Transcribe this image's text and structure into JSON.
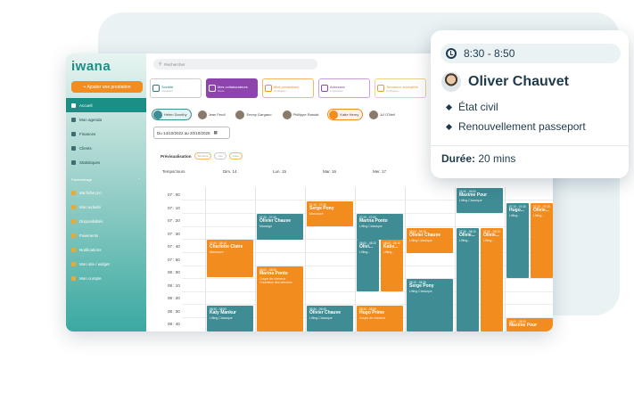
{
  "app": {
    "logo": "iwana",
    "search_placeholder": "Rechercher",
    "add_button": "+ Ajouter une prestation"
  },
  "sidebar": {
    "items": [
      {
        "label": "Accueil",
        "active": true
      },
      {
        "label": "Mon agenda"
      },
      {
        "label": "Finances"
      },
      {
        "label": "Clients"
      },
      {
        "label": "Statistiques"
      }
    ],
    "section": "Paramétrage",
    "section_items": [
      {
        "label": "Ma fiche pro"
      },
      {
        "label": "Mon activité"
      },
      {
        "label": "Disponibilités"
      },
      {
        "label": "Paiements"
      },
      {
        "label": "Notifications"
      },
      {
        "label": "Mon site / widget"
      },
      {
        "label": "Mon compte"
      }
    ]
  },
  "tiles": [
    {
      "label": "Société",
      "sub": "Visualiser",
      "style": "t"
    },
    {
      "label": "Mes collaborateurs",
      "sub": "Gérer",
      "style": "p"
    },
    {
      "label": "Mes prestations",
      "sub": "Configurer",
      "style": "o"
    },
    {
      "label": "Adresses",
      "sub": "2 adresses",
      "style": "v"
    },
    {
      "label": "Tendance souhaitée",
      "sub": "Configurer",
      "style": "y"
    }
  ],
  "people": [
    {
      "name": "Helen Dorothy",
      "sel": "sel1"
    },
    {
      "name": "Jean Ferdi",
      "sel": ""
    },
    {
      "name": "Emmy Gargano",
      "sel": ""
    },
    {
      "name": "Phillippe Randal",
      "sel": ""
    },
    {
      "name": "Katie Henry",
      "sel": "sel2"
    },
    {
      "name": "AJ O'Neil",
      "sel": ""
    }
  ],
  "dates": {
    "range": "Du 14/10/2022  au  20/10/2025"
  },
  "preview": {
    "label": "Prévisualisation",
    "pills": [
      "Semaine",
      "Jour",
      "Liste"
    ]
  },
  "calendar": {
    "corner": "Temps/Jours",
    "days": [
      "Dim. 14",
      "Lun. 15",
      "Mar. 16",
      "Mer. 17"
    ],
    "times": [
      "07 : 00",
      "07 : 10",
      "07 : 20",
      "07 : 30",
      "07 : 40",
      "07 : 50",
      "08 : 00",
      "08 : 10",
      "08 : 20",
      "08 : 30",
      "08 : 40"
    ]
  },
  "events": [
    {
      "time": "07:40 - 08:10",
      "name": "Charlotte Claire",
      "service": "Manucure",
      "color": "o"
    },
    {
      "time": "08:30 - 08:50",
      "name": "Katy Mankur",
      "service": "Lifting Classique",
      "color": "t"
    },
    {
      "time": "07:20 - 07:40",
      "name": "Olivier Chauve",
      "service": "Massage",
      "color": "t"
    },
    {
      "time": "08:00 - 08:30",
      "name": "Marina Ponto",
      "service": "Coupe de cheveux",
      "extra": "Coloration des cheveux",
      "color": "o"
    },
    {
      "time": "07:10 - 07:30",
      "name": "Serge Pony",
      "service": "Manucure",
      "color": "o"
    },
    {
      "time": "08:30 - 05:40",
      "name": "Olivier Chauve",
      "service": "Lifting Classique",
      "color": "t"
    },
    {
      "time": "07:20 - 07:50",
      "name": "Marina Ponto",
      "service": "Lifting Classique",
      "color": "t"
    },
    {
      "time": "08:00 - 08:20",
      "name": "Olivi...",
      "service": "Lifting...",
      "color": "t"
    },
    {
      "time": "08:00 - 08:10",
      "name": "Katie...",
      "service": "Lifting...",
      "color": "o"
    },
    {
      "time": "08:30 - 08:50",
      "name": "Hugo Prime",
      "service": "Coupe de cheveux",
      "color": "o"
    },
    {
      "time": "08:00 - 08:10",
      "name": "Olivier Chauve",
      "service": "Lifting Classique",
      "color": "o"
    },
    {
      "time": "08:10 - 08:30",
      "name": "Serge Pony",
      "service": "Lifting Classique",
      "color": "t"
    },
    {
      "time": "06:30 - 06:50",
      "name": "Maxime Pour",
      "service": "Lifting Classique",
      "color": "t"
    },
    {
      "time": "07:30 - 08:10",
      "name": "Olivie...",
      "service": "Lifting...",
      "color": "t"
    },
    {
      "time": "07:30 - 08:10",
      "name": "Olivie...",
      "service": "Lifting...",
      "color": "o"
    },
    {
      "time": "07:10 - 07:30",
      "name": "Hugo...",
      "service": "Lifting...",
      "color": "t"
    },
    {
      "time": "07:10 - 07:30",
      "name": "Olivie...",
      "service": "Lifting...",
      "color": "o"
    },
    {
      "time": "08:00 - 08:30",
      "name": "Maxime Pour",
      "service": "",
      "color": "o"
    }
  ],
  "popup": {
    "time": "8:30 - 8:50",
    "name": "Oliver Chauvet",
    "items": [
      "État civil",
      "Renouvellement passeport"
    ],
    "duration_label": "Durée:",
    "duration": "20 mins"
  },
  "colors": {
    "teal": "#3f8c94",
    "orange": "#f28c1f",
    "purple": "#8e44ad",
    "sidebar": "#1b8f86"
  }
}
